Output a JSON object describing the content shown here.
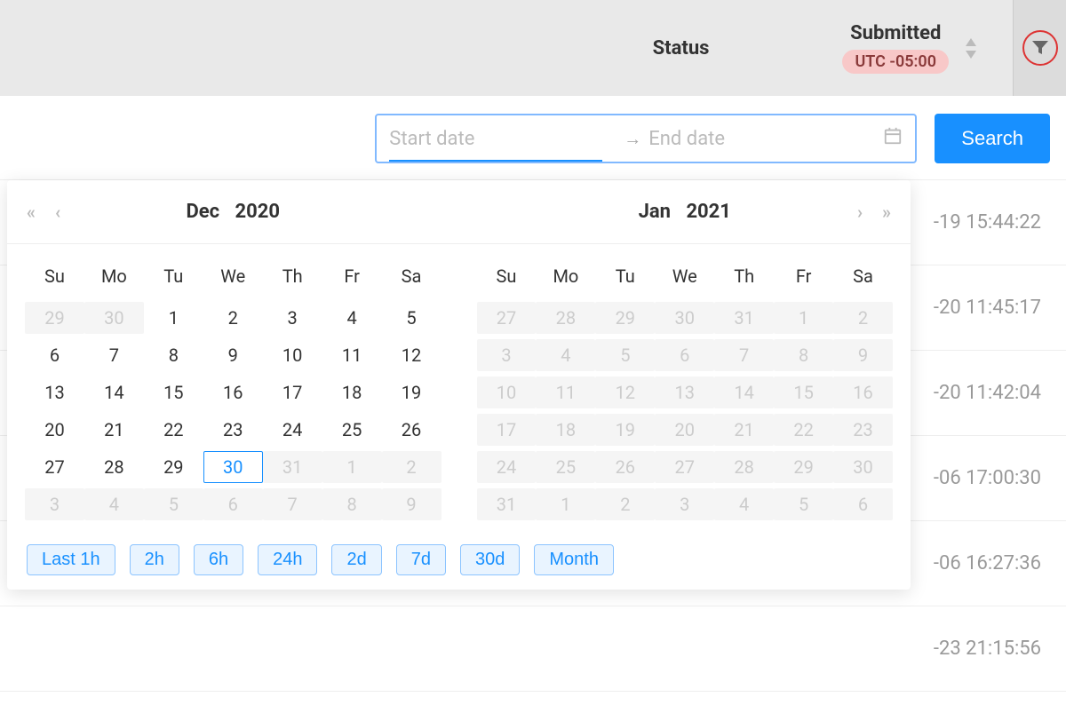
{
  "header": {
    "status_label": "Status",
    "submitted_label": "Submitted",
    "timezone": "UTC -05:00"
  },
  "search": {
    "start_placeholder": "Start date",
    "end_placeholder": "End date",
    "button": "Search"
  },
  "results": [
    "-19 15:44:22",
    "-20 11:45:17",
    "-20 11:42:04",
    "-06 17:00:30",
    "-06 16:27:36",
    "-23 21:15:56"
  ],
  "picker": {
    "left": {
      "month": "Dec",
      "year": "2020"
    },
    "right": {
      "month": "Jan",
      "year": "2021"
    },
    "dow": [
      "Su",
      "Mo",
      "Tu",
      "We",
      "Th",
      "Fr",
      "Sa"
    ],
    "left_weeks": [
      [
        {
          "d": "29",
          "o": true
        },
        {
          "d": "30",
          "o": true
        },
        {
          "d": "1"
        },
        {
          "d": "2"
        },
        {
          "d": "3"
        },
        {
          "d": "4"
        },
        {
          "d": "5"
        }
      ],
      [
        {
          "d": "6"
        },
        {
          "d": "7"
        },
        {
          "d": "8"
        },
        {
          "d": "9"
        },
        {
          "d": "10"
        },
        {
          "d": "11"
        },
        {
          "d": "12"
        }
      ],
      [
        {
          "d": "13"
        },
        {
          "d": "14"
        },
        {
          "d": "15"
        },
        {
          "d": "16"
        },
        {
          "d": "17"
        },
        {
          "d": "18"
        },
        {
          "d": "19"
        }
      ],
      [
        {
          "d": "20"
        },
        {
          "d": "21"
        },
        {
          "d": "22"
        },
        {
          "d": "23"
        },
        {
          "d": "24"
        },
        {
          "d": "25"
        },
        {
          "d": "26"
        }
      ],
      [
        {
          "d": "27"
        },
        {
          "d": "28"
        },
        {
          "d": "29"
        },
        {
          "d": "30",
          "t": true
        },
        {
          "d": "31",
          "o": true
        },
        {
          "d": "1",
          "o": true
        },
        {
          "d": "2",
          "o": true
        }
      ],
      [
        {
          "d": "3",
          "o": true
        },
        {
          "d": "4",
          "o": true
        },
        {
          "d": "5",
          "o": true
        },
        {
          "d": "6",
          "o": true
        },
        {
          "d": "7",
          "o": true
        },
        {
          "d": "8",
          "o": true
        },
        {
          "d": "9",
          "o": true
        }
      ]
    ],
    "right_weeks": [
      [
        {
          "d": "27",
          "o": true
        },
        {
          "d": "28",
          "o": true
        },
        {
          "d": "29",
          "o": true
        },
        {
          "d": "30",
          "o": true
        },
        {
          "d": "31",
          "o": true
        },
        {
          "d": "1",
          "o": true
        },
        {
          "d": "2",
          "o": true
        }
      ],
      [
        {
          "d": "3",
          "o": true
        },
        {
          "d": "4",
          "o": true
        },
        {
          "d": "5",
          "o": true
        },
        {
          "d": "6",
          "o": true
        },
        {
          "d": "7",
          "o": true
        },
        {
          "d": "8",
          "o": true
        },
        {
          "d": "9",
          "o": true
        }
      ],
      [
        {
          "d": "10",
          "o": true
        },
        {
          "d": "11",
          "o": true
        },
        {
          "d": "12",
          "o": true
        },
        {
          "d": "13",
          "o": true
        },
        {
          "d": "14",
          "o": true
        },
        {
          "d": "15",
          "o": true
        },
        {
          "d": "16",
          "o": true
        }
      ],
      [
        {
          "d": "17",
          "o": true
        },
        {
          "d": "18",
          "o": true
        },
        {
          "d": "19",
          "o": true
        },
        {
          "d": "20",
          "o": true
        },
        {
          "d": "21",
          "o": true
        },
        {
          "d": "22",
          "o": true
        },
        {
          "d": "23",
          "o": true
        }
      ],
      [
        {
          "d": "24",
          "o": true
        },
        {
          "d": "25",
          "o": true
        },
        {
          "d": "26",
          "o": true
        },
        {
          "d": "27",
          "o": true
        },
        {
          "d": "28",
          "o": true
        },
        {
          "d": "29",
          "o": true
        },
        {
          "d": "30",
          "o": true
        }
      ],
      [
        {
          "d": "31",
          "o": true
        },
        {
          "d": "1",
          "o": true
        },
        {
          "d": "2",
          "o": true
        },
        {
          "d": "3",
          "o": true
        },
        {
          "d": "4",
          "o": true
        },
        {
          "d": "5",
          "o": true
        },
        {
          "d": "6",
          "o": true
        }
      ]
    ],
    "presets": [
      "Last 1h",
      "2h",
      "6h",
      "24h",
      "2d",
      "7d",
      "30d",
      "Month"
    ]
  }
}
